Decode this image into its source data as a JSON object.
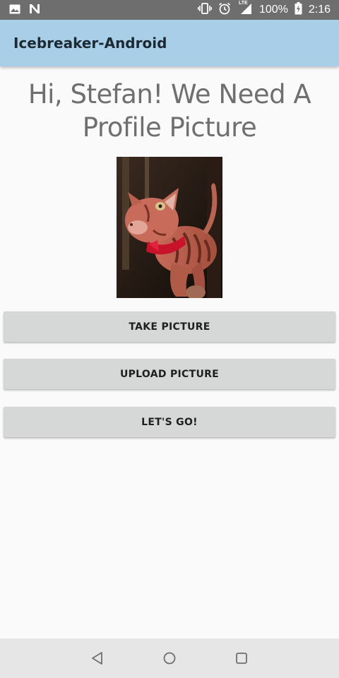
{
  "status_bar": {
    "battery": "100%",
    "time": "2:16",
    "network_label": "LTE",
    "icons": [
      "image-icon",
      "n-notification-icon",
      "vibrate-icon",
      "alarm-icon",
      "signal-icon",
      "battery-charging-icon"
    ]
  },
  "app_bar": {
    "title": "Icebreaker-Android",
    "color": "#a9cfe8"
  },
  "main": {
    "headline_line1": "Hi, Stefan! We Need A",
    "headline_line2": "Profile Picture",
    "photo_subject": "cat-photo"
  },
  "buttons": {
    "take_picture": "TAKE PICTURE",
    "upload_picture": "UPLOAD PICTURE",
    "lets_go": "LET'S GO!"
  },
  "nav_bar": {
    "icons": [
      "back-icon",
      "home-icon",
      "recents-icon"
    ]
  }
}
